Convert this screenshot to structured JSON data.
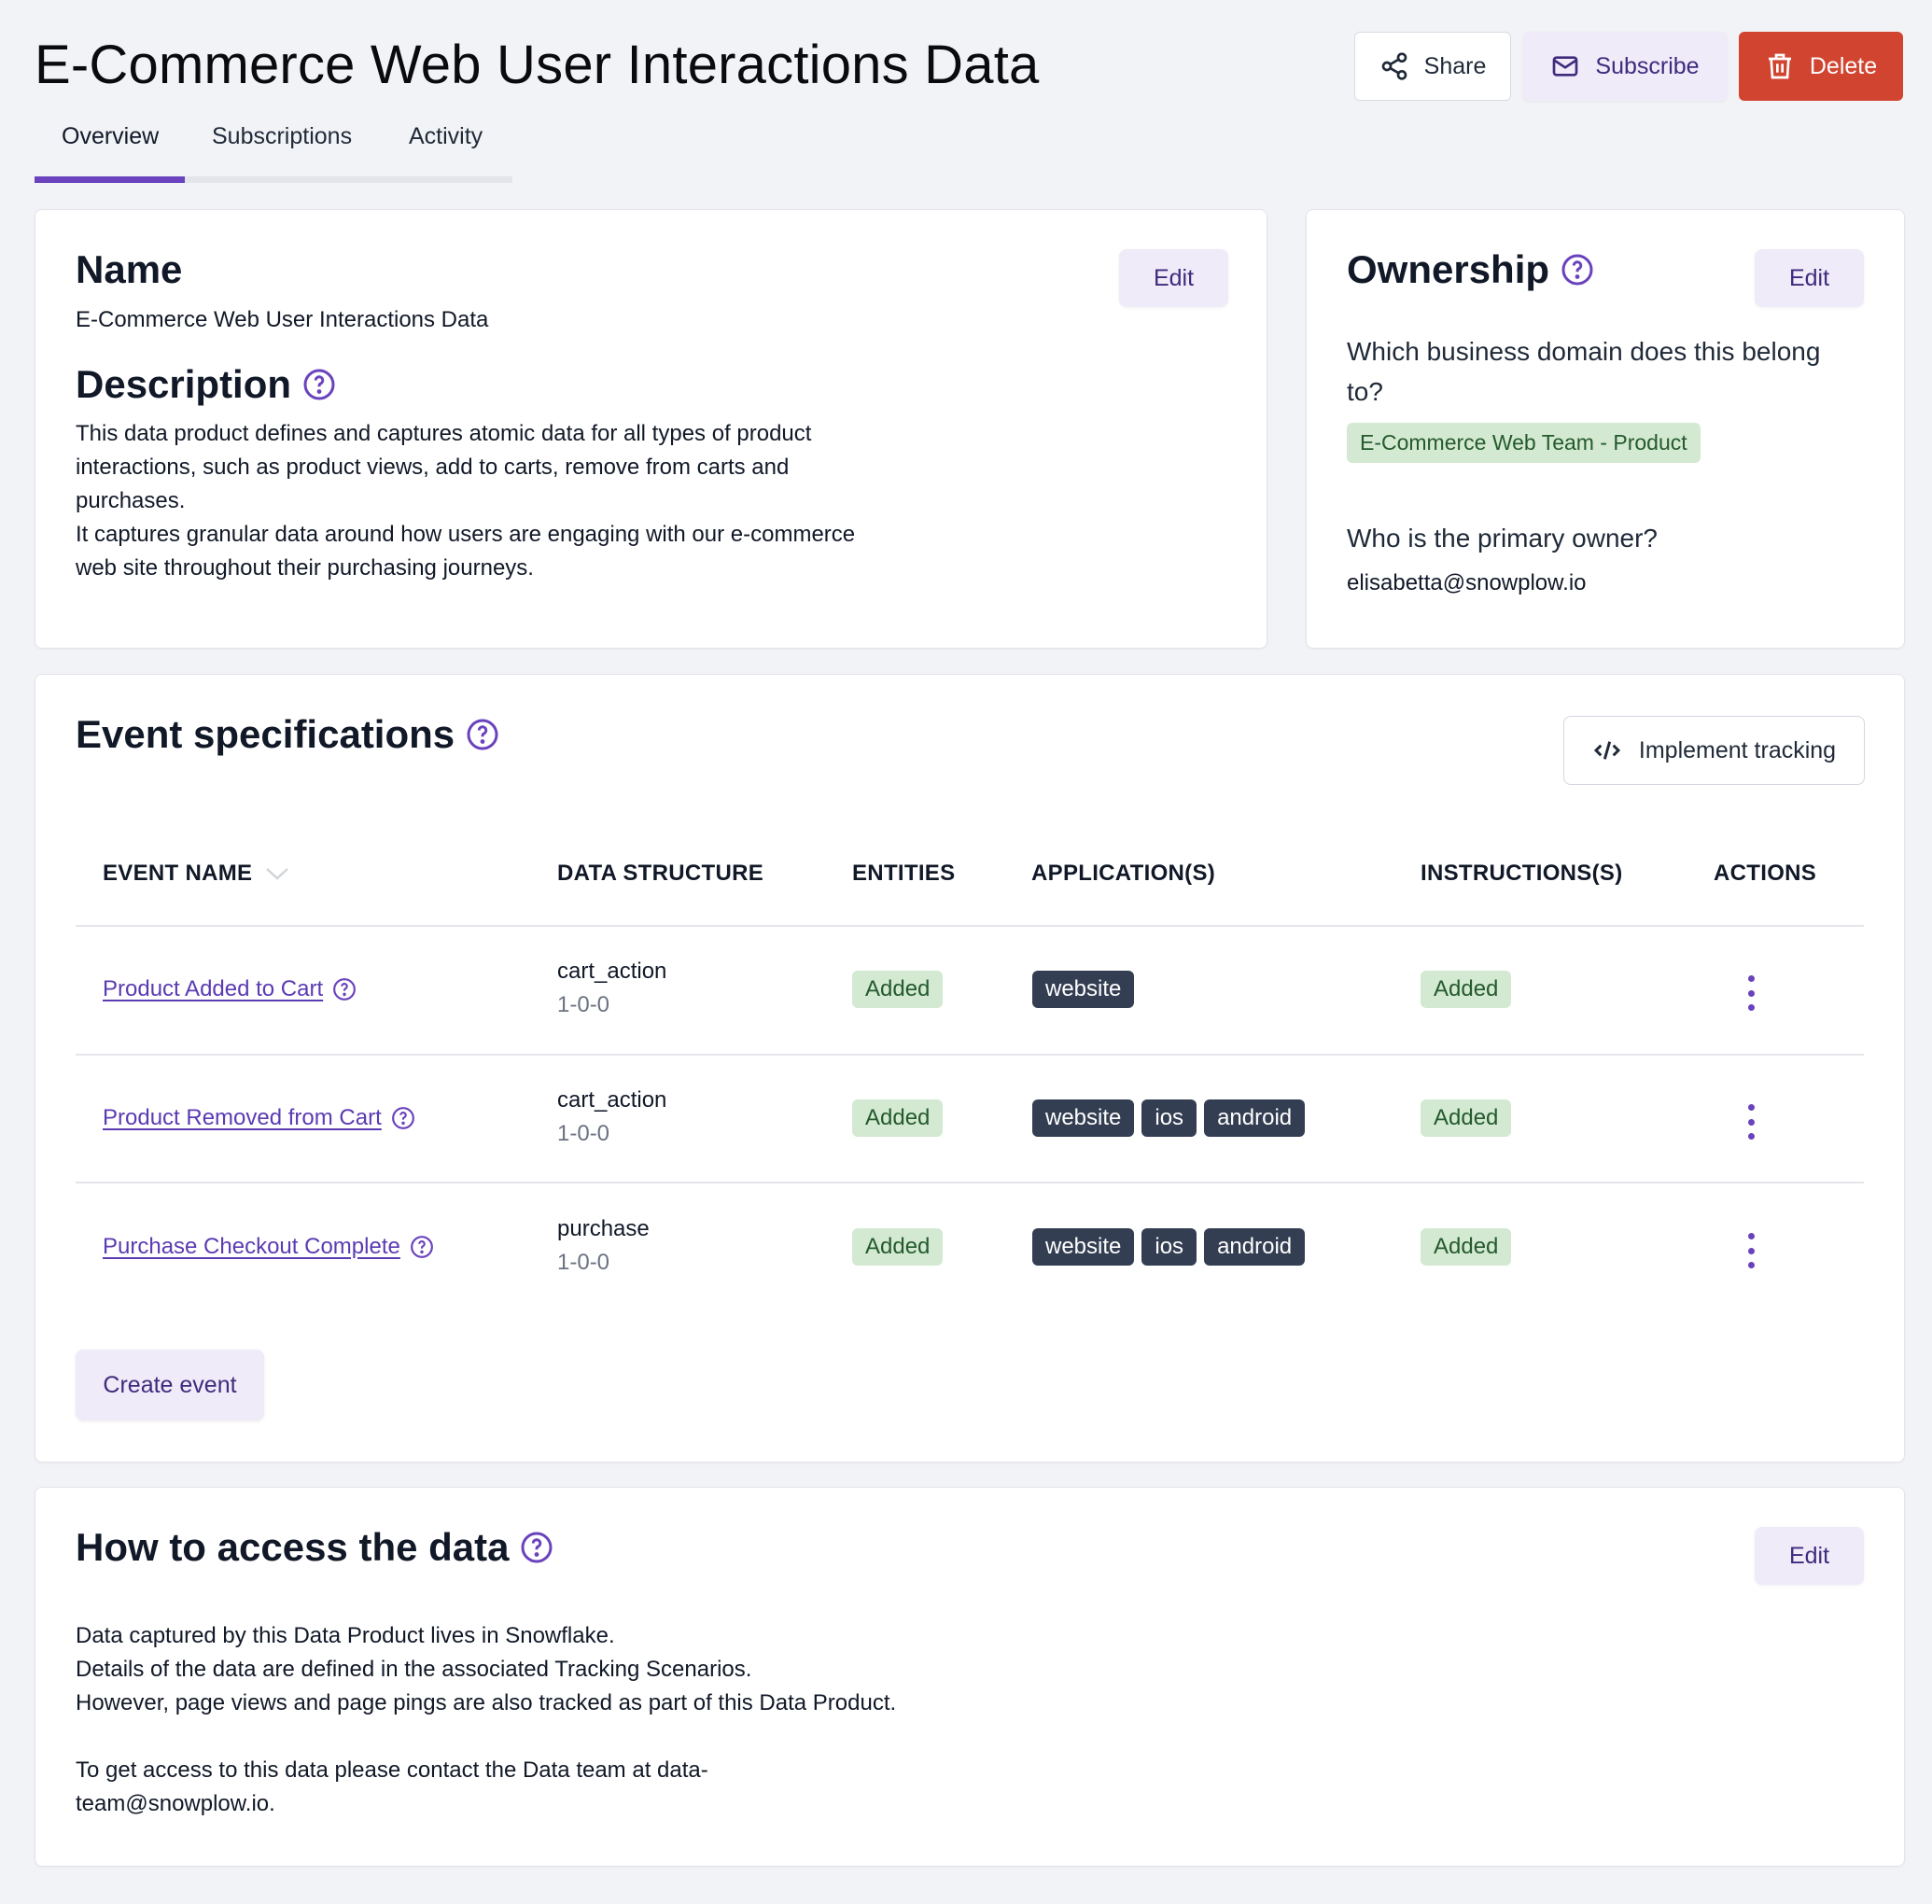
{
  "header": {
    "title": "E-Commerce Web User Interactions Data",
    "actions": {
      "share_label": "Share",
      "subscribe_label": "Subscribe",
      "delete_label": "Delete"
    }
  },
  "tabs": [
    {
      "label": "Overview",
      "active": true
    },
    {
      "label": "Subscriptions",
      "active": false
    },
    {
      "label": "Activity",
      "active": false
    }
  ],
  "name_card": {
    "name_heading": "Name",
    "name_value": "E-Commerce Web User Interactions Data",
    "edit_label": "Edit",
    "description_heading": "Description",
    "description_lines": [
      "This data product defines and captures atomic data for all types of product",
      "interactions, such as product views, add to carts, remove from carts and",
      "purchases.",
      "It captures granular data around how users are engaging with our e-commerce",
      "web site throughout their purchasing journeys."
    ]
  },
  "ownership_card": {
    "heading": "Ownership",
    "edit_label": "Edit",
    "domain_question_line1": "Which business domain does this belong",
    "domain_question_line2": "to?",
    "domain_value": "E-Commerce Web Team - Product",
    "owner_question": "Who is the primary owner?",
    "owner_value": "elisabetta@snowplow.io"
  },
  "event_specs": {
    "heading": "Event specifications",
    "implement_label": "Implement tracking",
    "columns": {
      "event_name": "EVENT NAME",
      "data_structure": "DATA STRUCTURE",
      "entities": "ENTITIES",
      "applications": "APPLICATION(S)",
      "instructions": "INSTRUCTIONS(S)",
      "actions": "ACTIONS"
    },
    "rows": [
      {
        "event_name": "Product Added to Cart",
        "data_structure": "cart_action",
        "version": "1-0-0",
        "entities": "Added",
        "applications": [
          "website"
        ],
        "instructions": "Added"
      },
      {
        "event_name": "Product Removed from Cart",
        "data_structure": "cart_action",
        "version": "1-0-0",
        "entities": "Added",
        "applications": [
          "website",
          "ios",
          "android"
        ],
        "instructions": "Added"
      },
      {
        "event_name": "Purchase Checkout Complete",
        "data_structure": "purchase",
        "version": "1-0-0",
        "entities": "Added",
        "applications": [
          "website",
          "ios",
          "android"
        ],
        "instructions": "Added"
      }
    ],
    "create_label": "Create event"
  },
  "access_card": {
    "heading": "How to access the data",
    "edit_label": "Edit",
    "lines": [
      "Data captured by this Data Product lives in Snowflake.",
      "Details of the data are defined in the associated Tracking Scenarios.",
      "However, page views and page pings are also tracked as part of this Data Product.",
      "",
      "To get access to this data please contact the Data team at data-",
      "team@snowplow.io."
    ]
  },
  "colors": {
    "accent": "#6a42bd",
    "delete": "#d14530",
    "badge_green_bg": "#d3e9d1",
    "badge_green_text": "#245a2e",
    "app_chip_bg": "#343e52",
    "secondary_btn_bg": "#efebf8"
  }
}
